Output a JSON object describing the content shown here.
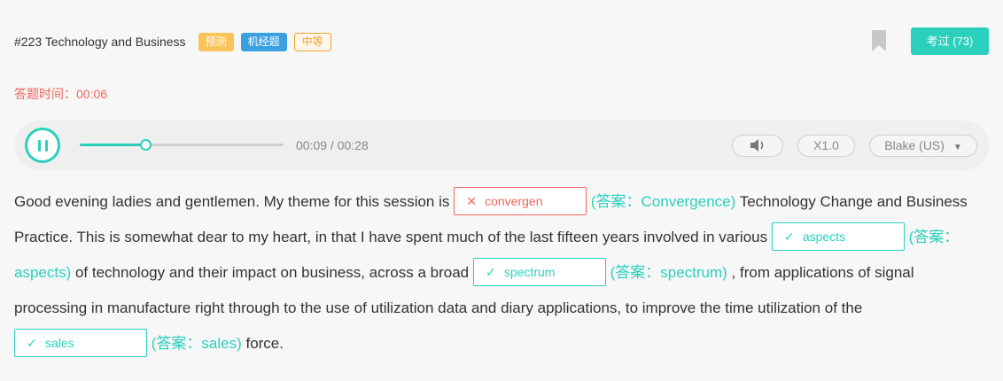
{
  "header": {
    "question_title": "#223 Technology and Business",
    "tags": [
      "预测",
      "机经题",
      "中等"
    ],
    "exam_button": "考过 (73)"
  },
  "timer": {
    "label": "答题时间：",
    "value": "00:06"
  },
  "player": {
    "progress_fraction": 0.321,
    "current_time": "00:09",
    "total_time": "00:28",
    "time_separator": " / ",
    "speed": "X1.0",
    "voice": "Blake (US)"
  },
  "passage": {
    "seg1": "Good evening ladies and gentlemen. My theme for this session is ",
    "blank1": {
      "value": "convergen",
      "status": "wrong"
    },
    "ans1": "(答案：Convergence)",
    "seg2": " Technology Change and Business Practice. This is somewhat dear to my heart, in that I have spent much of the last fifteen years involved in various ",
    "blank2": {
      "value": "aspects",
      "status": "correct"
    },
    "ans2": "(答案：aspects)",
    "seg3": " of technology and their impact on business, across a broad ",
    "blank3": {
      "value": "spectrum",
      "status": "correct"
    },
    "ans3": "(答案：spectrum)",
    "seg4": " , from applications of signal processing in manufacture right through to the use of utilization data and diary applications, to improve the time utilization of the ",
    "blank4": {
      "value": "sales",
      "status": "correct"
    },
    "ans4": "(答案：sales)",
    "seg5": " force."
  },
  "icons": {
    "wrong": "✕",
    "correct": "✓",
    "volume": "speaker-icon",
    "dropdown": "caret-down-icon",
    "bookmark": "bookmark-icon",
    "pause": "pause-icon"
  },
  "colors": {
    "accent": "#2bd0bd",
    "error": "#f2665c",
    "tag_predict": "#f7c35a",
    "tag_jijing": "#3aa0e2",
    "tag_level": "#f0a030"
  }
}
